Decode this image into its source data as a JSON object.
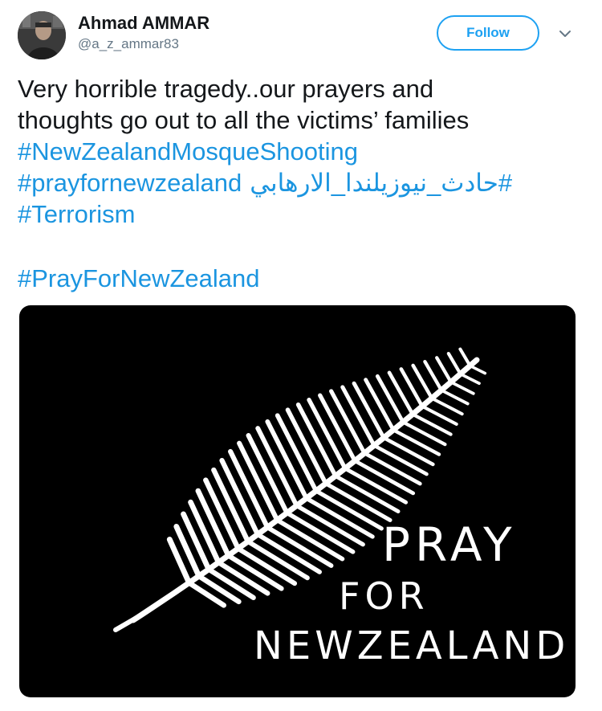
{
  "user": {
    "display_name": "Ahmad AMMAR",
    "handle": "@a_z_ammar83"
  },
  "actions": {
    "follow_label": "Follow",
    "more_icon": "chevron-down-icon"
  },
  "tweet": {
    "line1": "Very horrible tragedy..our prayers and",
    "line2": "thoughts go out to all the victims’ families",
    "hashtag_mosque": "#NewZealandMosqueShooting",
    "hashtag_pray_lower": "#prayfornewzealand",
    "hashtag_arabic": "#حادث_نيوزيلندا_الارهابي",
    "hashtag_terrorism": "#Terrorism",
    "hashtag_pray_camel": "#PrayForNewZealand"
  },
  "media": {
    "icon": "silver-fern-icon",
    "line1": "PRAY",
    "line2": "FOR",
    "line3": "NEWZEALAND"
  },
  "colors": {
    "link": "#1b95e0",
    "follow": "#1da1f2",
    "text": "#14171a",
    "secondary": "#657786",
    "media_bg": "#000000",
    "fern": "#ffffff"
  }
}
